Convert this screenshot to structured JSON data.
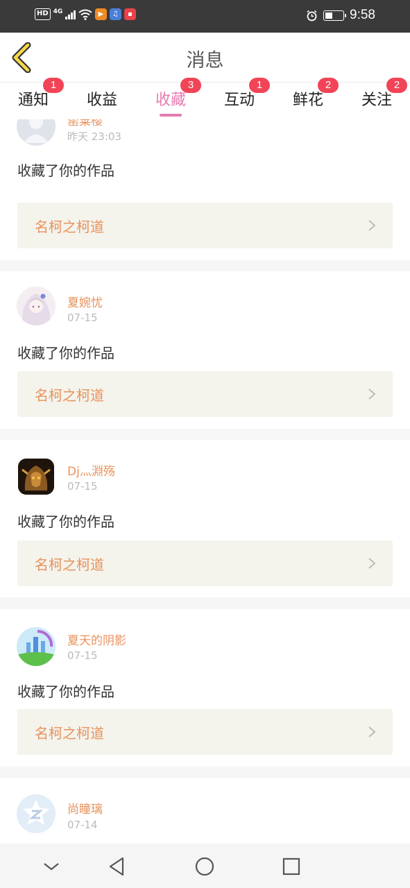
{
  "status_bar": {
    "hd_label": "HD",
    "network_label": "4G",
    "time": "9:58",
    "battery_level_percent": 40,
    "icons": [
      "signal-icon",
      "wifi-icon",
      "video-app-icon",
      "music-app-icon",
      "shop-app-icon",
      "alarm-icon",
      "battery-icon"
    ]
  },
  "header": {
    "title": "消息",
    "back_icon": "chevron-left-icon"
  },
  "tabs": [
    {
      "label": "通知",
      "badge": "1"
    },
    {
      "label": "收益",
      "badge": ""
    },
    {
      "label": "收藏",
      "badge": "3"
    },
    {
      "label": "互动",
      "badge": "1"
    },
    {
      "label": "鲜花",
      "badge": "2"
    },
    {
      "label": "关注",
      "badge": "2"
    }
  ],
  "active_tab_index": 2,
  "feed": [
    {
      "user": "罂粟樱",
      "time": "昨天 23:03",
      "action": "收藏了你的作品",
      "work": "名柯之柯道",
      "avatar": "default-avatar-icon"
    },
    {
      "user": "夏婉忧",
      "time": "07-15",
      "action": "收藏了你的作品",
      "work": "名柯之柯道",
      "avatar": "anime-girl-avatar"
    },
    {
      "user": "Dj灬淵殇",
      "time": "07-15",
      "action": "收藏了你的作品",
      "work": "名柯之柯道",
      "avatar": "warrior-avatar"
    },
    {
      "user": "夏天的阴影",
      "time": "07-15",
      "action": "收藏了你的作品",
      "work": "名柯之柯道",
      "avatar": "castle-avatar"
    },
    {
      "user": "尚瞳璃",
      "time": "07-14",
      "action": "",
      "work": "",
      "avatar": "qq-default-avatar"
    }
  ],
  "colors": {
    "accent_pink": "#e87ab0",
    "username_orange": "#e8925c",
    "badge_red": "#f24457",
    "work_box_bg": "#f4f3ec",
    "status_bar_bg": "#3a3a3a"
  },
  "navbar": {
    "icons": [
      "collapse-chevron-icon",
      "back-triangle-icon",
      "home-circle-icon",
      "recent-square-icon"
    ]
  }
}
